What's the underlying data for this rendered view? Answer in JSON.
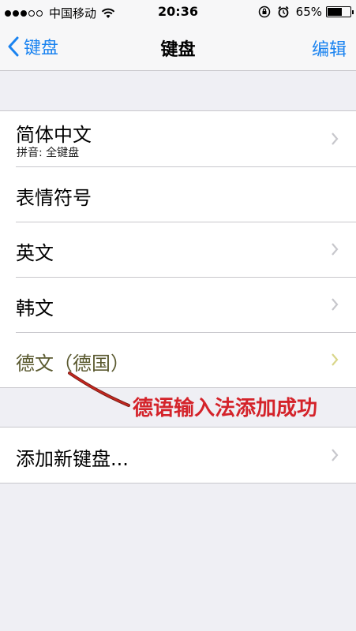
{
  "status_bar": {
    "carrier": "中国移动",
    "time": "20:36",
    "battery_percent_label": "65%",
    "battery_level": 0.65,
    "signal_bars_filled": 3,
    "signal_bars_total": 5,
    "icons": [
      "wifi-icon",
      "rotation-lock-icon",
      "alarm-icon",
      "battery-icon"
    ]
  },
  "nav": {
    "back_label": "键盘",
    "title": "键盘",
    "edit_label": "编辑"
  },
  "keyboards": [
    {
      "title": "简体中文",
      "subtitle": "拼音: 全键盘"
    },
    {
      "title": "表情符号"
    },
    {
      "title": "英文"
    },
    {
      "title": "韩文"
    },
    {
      "title": "德文（德国）"
    }
  ],
  "add_keyboard_label": "添加新键盘...",
  "annotation": {
    "text": "德语输入法添加成功",
    "color": "#d4232a",
    "highlight_color": "#fdf985"
  },
  "colors": {
    "accent": "#1a83f0",
    "background": "#efeff4"
  }
}
